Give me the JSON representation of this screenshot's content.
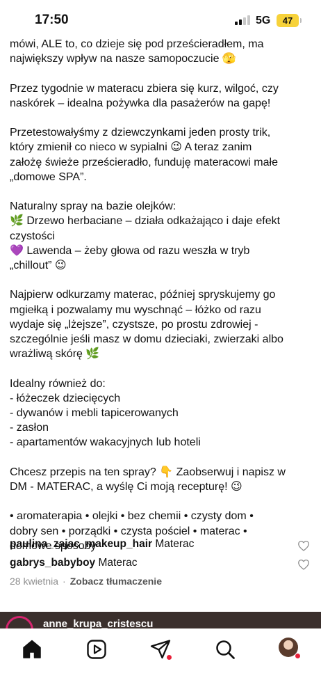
{
  "status_bar": {
    "time": "17:50",
    "network": "5G",
    "battery": "47"
  },
  "caption": {
    "paragraphs": [
      [
        "mówi, ALE to, co dzieje się pod prześcieradłem, ma",
        "największy wpływ na nasze samopoczucie 🫣"
      ],
      [
        "Przez tygodnie w materacu zbiera się kurz, wilgoć, czy",
        "naskórek – idealna pożywka dla pasażerów na gapę!"
      ],
      [
        "Przetestowałyśmy z dziewczynkami jeden prosty trik,",
        "który zmienił co nieco w sypialni 😉 A teraz zanim",
        "założę świeże prześcieradło, funduję materacowi małe",
        "„domowe SPA”."
      ],
      [
        "Naturalny spray na bazie olejków:",
        "🌿 Drzewo herbaciane – działa odkażająco i daje efekt",
        "czystości",
        "💜 Lawenda – żeby głowa od razu weszła w tryb",
        "„chillout” 😉"
      ],
      [
        "Najpierw odkurzamy materac, później spryskujemy go",
        "mgiełką i pozwalamy mu wyschnąć – łóżko od razu",
        "wydaje się „lżejsze”, czystsze, po prostu zdrowiej -",
        "szczególnie jeśli masz w domu dzieciaki, zwierzaki albo",
        "wrażliwą skórę 🌿"
      ],
      [
        "Idealny również do:",
        "- łóżeczek dziecięcych",
        "- dywanów i mebli tapicerowanych",
        "- zasłon",
        "- apartamentów wakacyjnych lub hoteli"
      ],
      [
        "Chcesz przepis na ten spray? 👇 Zaobserwuj i napisz w",
        "DM - MATERAC, a wyślę Ci moją recepturę! 😉"
      ]
    ],
    "hashtags": [
      "• aromaterapia • olejki • bez chemii • czysty dom •",
      "dobry sen • porządki • czysta pościel • materac •",
      "domowe sposoby"
    ]
  },
  "comments": [
    {
      "user": "paulina_zajac_makeup_hair",
      "text": "Materac"
    },
    {
      "user": "gabrys_babyboy",
      "text": "Materac"
    }
  ],
  "meta": {
    "date": "28 kwietnia",
    "separator": "·",
    "translate": "Zobacz tłumaczenie"
  },
  "next_post": {
    "username": "anne_krupa_cristescu"
  },
  "tabbar": {
    "items": [
      "home-icon",
      "reels-icon",
      "direct-messages-icon",
      "search-icon",
      "profile-avatar"
    ],
    "notification_color": "#e8203a"
  }
}
